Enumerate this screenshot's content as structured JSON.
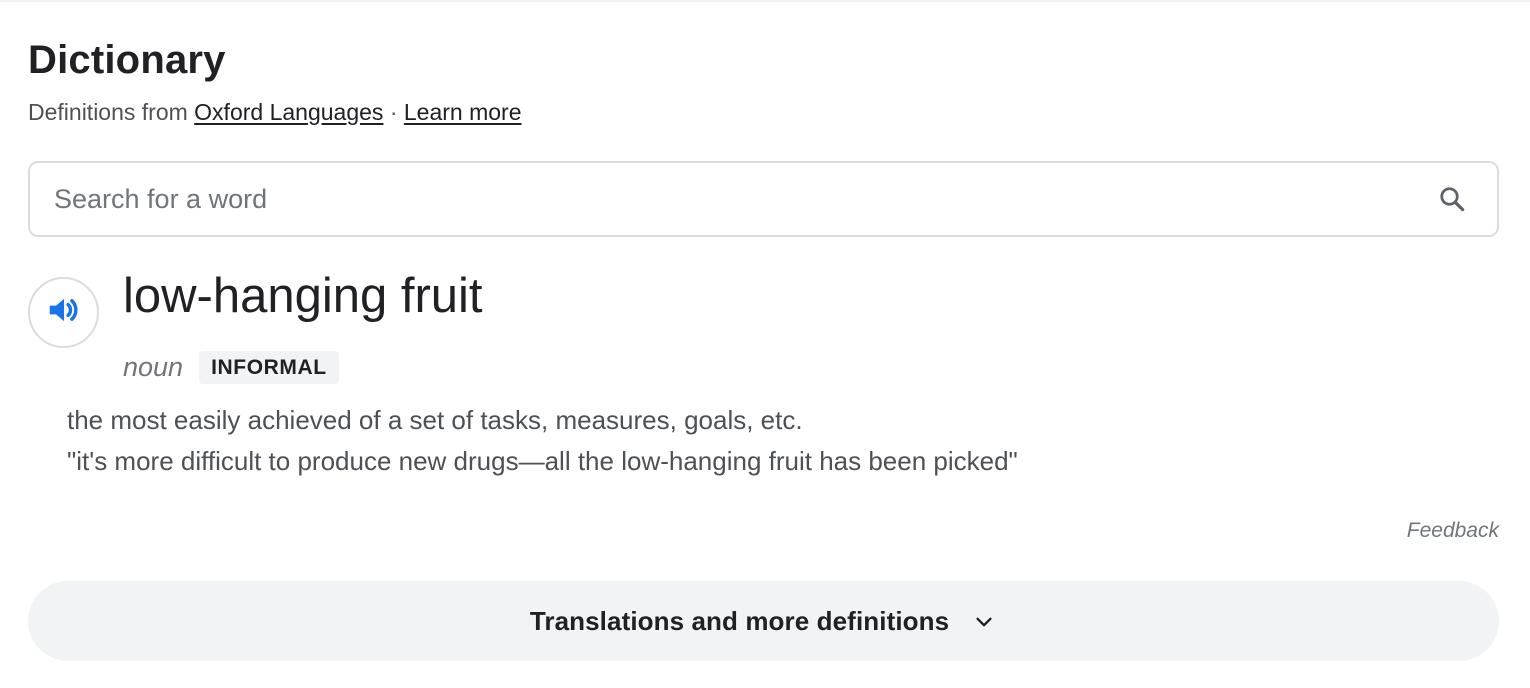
{
  "header": {
    "title": "Dictionary",
    "source_prefix": "Definitions from",
    "source_link": "Oxford Languages",
    "separator": "·",
    "learn_more": "Learn more"
  },
  "search": {
    "placeholder": "Search for a word",
    "value": "",
    "icon": "search-icon"
  },
  "entry": {
    "pronounce_icon": "speaker-icon",
    "headword": "low-hanging fruit",
    "part_of_speech": "noun",
    "register_label": "INFORMAL",
    "definition": "the most easily achieved of a set of tasks, measures, goals, etc.",
    "example": "\"it's more difficult to produce new drugs—all the low-hanging fruit has been picked\""
  },
  "feedback": "Feedback",
  "more_button": {
    "label": "Translations and more definitions",
    "icon": "chevron-down-icon"
  },
  "colors": {
    "accent_blue": "#1a73e8",
    "text_primary": "#202124",
    "text_secondary": "#4d5156",
    "text_muted": "#70757a",
    "border": "#dadce0",
    "chip_bg": "#f1f3f4"
  }
}
